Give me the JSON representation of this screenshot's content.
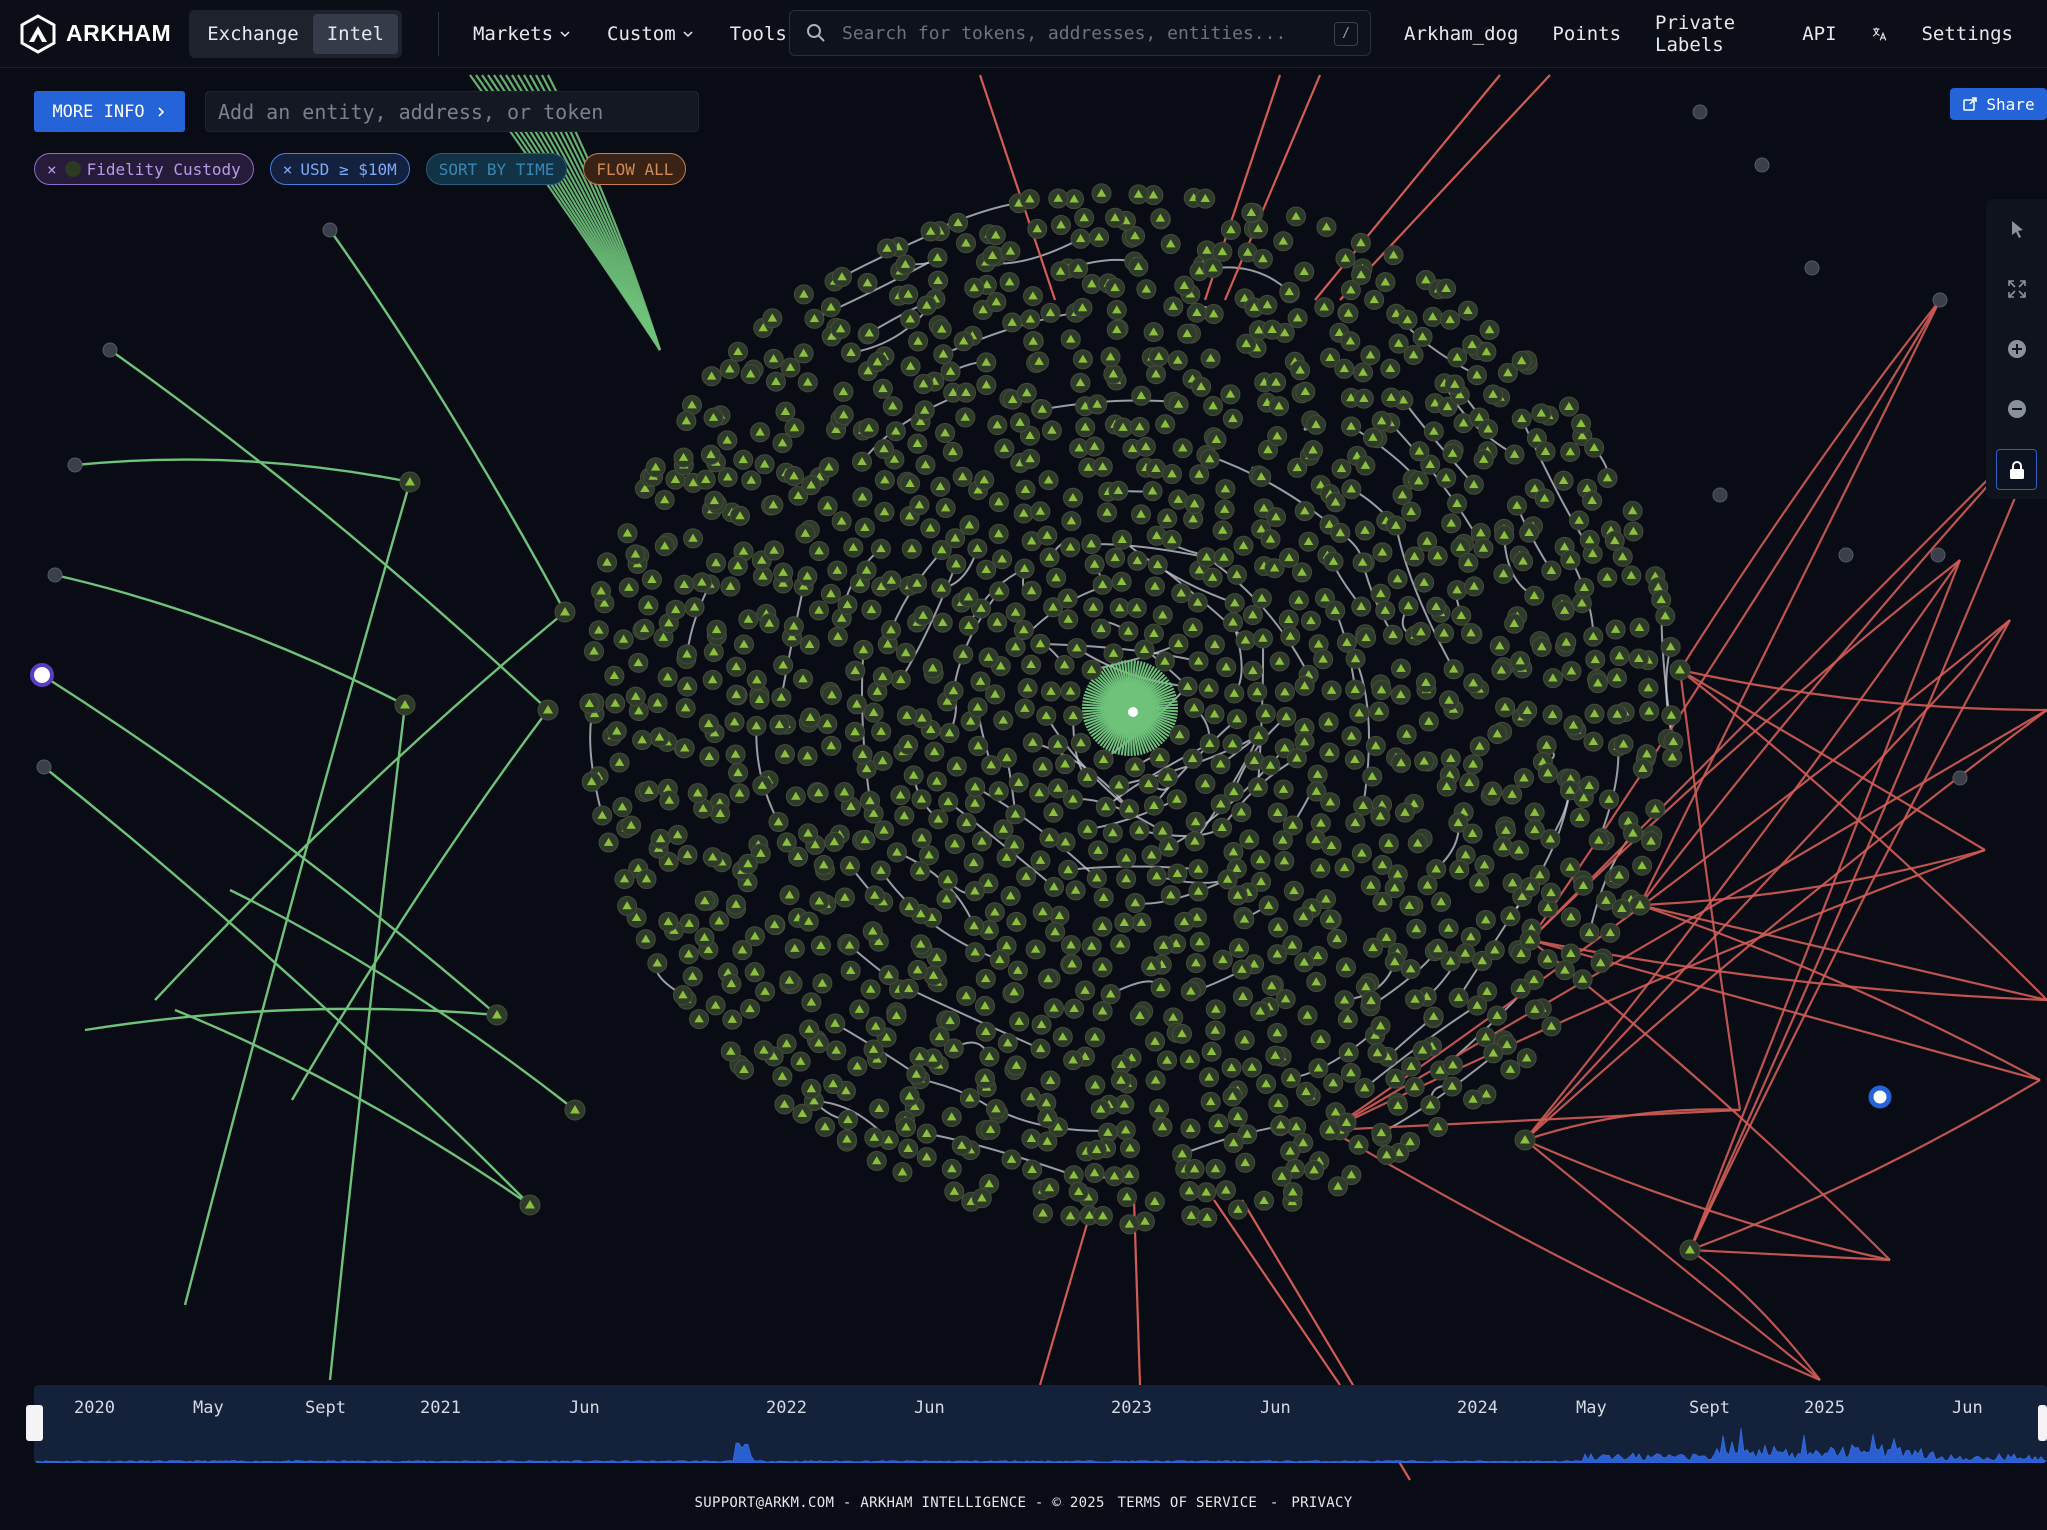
{
  "brand": {
    "name": "ARKHAM"
  },
  "modes": {
    "exchange": "Exchange",
    "intel": "Intel"
  },
  "nav": {
    "markets": "Markets",
    "custom": "Custom",
    "tools": "Tools"
  },
  "search": {
    "placeholder": "Search for tokens, addresses, entities...",
    "shortcut": "/"
  },
  "right_nav": {
    "user": "Arkham_dog",
    "points": "Points",
    "private_labels": "Private Labels",
    "api": "API",
    "settings": "Settings"
  },
  "toolbar": {
    "more_info_label": "MORE INFO",
    "entity_placeholder": "Add an entity, address, or token",
    "share_label": "Share"
  },
  "filters": {
    "entity": "Fidelity Custody",
    "usd": "USD ≥ $10M",
    "sort": "SORT BY TIME",
    "flow": "FLOW ALL"
  },
  "graph": {
    "edge_colors": {
      "inflow": "#6fc27a",
      "outflow": "#d25c55",
      "neutral": "#c9cdd4"
    },
    "node_color": "#2e3a2a",
    "node_glyph_color": "#8bbf3c"
  },
  "timeline": {
    "labels": [
      "2020",
      "May",
      "Sept",
      "2021",
      "Jun",
      "2022",
      "Jun",
      "2023",
      "Jun",
      "2024",
      "May",
      "Sept",
      "2025",
      "Jun"
    ]
  },
  "footer": {
    "support": "SUPPORT@ARKM.COM - ARKHAM INTELLIGENCE - © 2025",
    "terms": "TERMS OF SERVICE",
    "sep": "-",
    "privacy": "PRIVACY"
  }
}
